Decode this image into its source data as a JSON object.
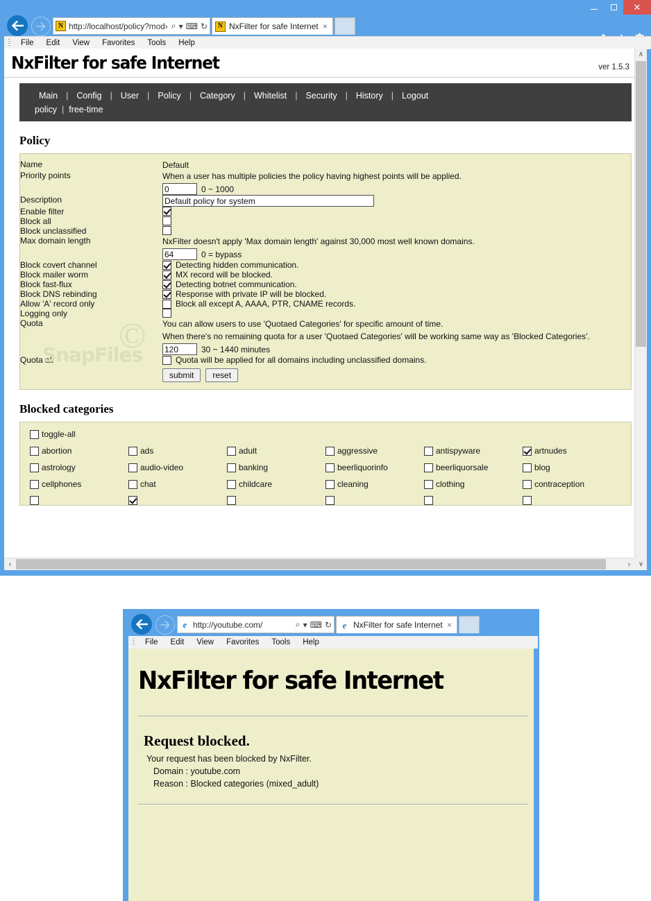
{
  "browser_main": {
    "window_controls": {
      "minimize": "–",
      "maximize": "□",
      "close": "×"
    },
    "back_label": "back-arrow",
    "forward_label": "forward-arrow",
    "url_prefix": "http://",
    "url_host": "localhost",
    "url_rest": "/policy?mod›",
    "url_full": "http://localhost/policy?mod›",
    "addr_icons": {
      "search": "⌕",
      "compat": "⌨",
      "refresh": "↻",
      "dropdown": "▾"
    },
    "tab_title": "NxFilter for safe Internet",
    "tab_close": "×",
    "command_icons": {
      "home": "home-icon",
      "favorites": "star-icon",
      "tools": "gear-icon"
    },
    "menu": [
      "File",
      "Edit",
      "View",
      "Favorites",
      "Tools",
      "Help"
    ]
  },
  "page": {
    "logo": "NxFilter for safe Internet",
    "version": "ver 1.5.3",
    "nav_primary": [
      "Main",
      "Config",
      "User",
      "Policy",
      "Category",
      "Whitelist",
      "Security",
      "History",
      "Logout"
    ],
    "nav_secondary": [
      "policy",
      "free-time"
    ],
    "policy_section_title": "Policy",
    "form": {
      "rows": [
        {
          "label": "Name",
          "type": "text-static",
          "value": "Default"
        },
        {
          "label": "Priority points",
          "type": "input",
          "hint": "When a user has multiple policies the policy having highest points will be applied.",
          "value": "0",
          "suffix": "0 ~ 1000"
        },
        {
          "label": "Description",
          "type": "input-wide",
          "value": "Default policy for system",
          "suffix": ""
        },
        {
          "label": "Enable filter",
          "type": "checkbox",
          "checked": true,
          "text": ""
        },
        {
          "label": "Block all",
          "type": "checkbox",
          "checked": false,
          "text": ""
        },
        {
          "label": "Block unclassified",
          "type": "checkbox",
          "checked": false,
          "text": ""
        },
        {
          "label": "Max domain length",
          "type": "input",
          "hint": "NxFilter doesn't apply 'Max domain length' against 30,000 most well known domains.",
          "value": "64",
          "suffix": "0 = bypass"
        },
        {
          "label": "Block covert channel",
          "type": "checkbox",
          "checked": true,
          "text": "Detecting hidden communication."
        },
        {
          "label": "Block mailer worm",
          "type": "checkbox",
          "checked": true,
          "text": "MX record will be blocked."
        },
        {
          "label": "Block fast-flux",
          "type": "checkbox",
          "checked": true,
          "text": "Detecting botnet communication."
        },
        {
          "label": "Block DNS rebinding",
          "type": "checkbox",
          "checked": true,
          "text": "Response with private IP will be blocked."
        },
        {
          "label": "Allow 'A' record only",
          "type": "checkbox",
          "checked": false,
          "text": "Block all except A, AAAA, PTR, CNAME records."
        },
        {
          "label": "Logging only",
          "type": "checkbox",
          "checked": false,
          "text": ""
        },
        {
          "label": "Quota",
          "type": "input",
          "hint": "You can allow users to use 'Quotaed Categories' for specific amount of time.",
          "hint2": "When there's no remaining quota for a user 'Quotaed Categories' will be working same way as 'Blocked Categories'.",
          "value": "120",
          "suffix": "30 ~ 1440 minutes"
        },
        {
          "label": "Quota all",
          "type": "checkbox",
          "checked": false,
          "text": "Quota will be applied for all domains including unclassified domains."
        }
      ],
      "submit_label": "submit",
      "reset_label": "reset"
    },
    "blocked_categories_title": "Blocked categories",
    "toggle_all": {
      "label": "toggle-all",
      "checked": false
    },
    "categories": [
      {
        "label": "abortion",
        "checked": false
      },
      {
        "label": "ads",
        "checked": false
      },
      {
        "label": "adult",
        "checked": false
      },
      {
        "label": "aggressive",
        "checked": false
      },
      {
        "label": "antispyware",
        "checked": false
      },
      {
        "label": "artnudes",
        "checked": true
      },
      {
        "label": "astrology",
        "checked": false
      },
      {
        "label": "audio-video",
        "checked": false
      },
      {
        "label": "banking",
        "checked": false
      },
      {
        "label": "beerliquorinfo",
        "checked": false
      },
      {
        "label": "beerliquorsale",
        "checked": false
      },
      {
        "label": "blog",
        "checked": false
      },
      {
        "label": "cellphones",
        "checked": false
      },
      {
        "label": "chat",
        "checked": false
      },
      {
        "label": "childcare",
        "checked": false
      },
      {
        "label": "cleaning",
        "checked": false
      },
      {
        "label": "clothing",
        "checked": false
      },
      {
        "label": "contraception",
        "checked": false
      }
    ],
    "partial_row": [
      {
        "label": "",
        "checked": false
      },
      {
        "label": "",
        "checked": true
      },
      {
        "label": "",
        "checked": false
      },
      {
        "label": "",
        "checked": false
      },
      {
        "label": "",
        "checked": false
      },
      {
        "label": "",
        "checked": false
      }
    ],
    "watermark": {
      "symbol": "©",
      "text": "SnapFiles"
    }
  },
  "scrollbars": {
    "v_up": "∧",
    "v_down": "∨",
    "h_left": "‹",
    "h_right": "›"
  },
  "browser_block": {
    "url_prefix": "http://",
    "url_host": "youtube.com",
    "url_rest": "/",
    "url_full": "http://youtube.com/",
    "tab_title": "NxFilter for safe Internet",
    "tab_close": "×",
    "menu": [
      "File",
      "Edit",
      "View",
      "Favorites",
      "Tools",
      "Help"
    ],
    "addr_icons": {
      "search": "⌕",
      "compat": "⌨",
      "refresh": "↻",
      "dropdown": "▾"
    }
  },
  "block_page": {
    "logo": "NxFilter for safe Internet",
    "heading": "Request blocked.",
    "message": "Your request has been blocked by NxFilter.",
    "domain_line": "Domain : youtube.com",
    "reason_line": "Reason : Blocked categories (mixed_adult)"
  },
  "colors": {
    "window_chrome": "#5aa3e8",
    "page_bg": "#eeeecb",
    "navbar_bg": "#3f3f3f",
    "close_button": "#d9534f",
    "accent_blue": "#1675c0"
  }
}
